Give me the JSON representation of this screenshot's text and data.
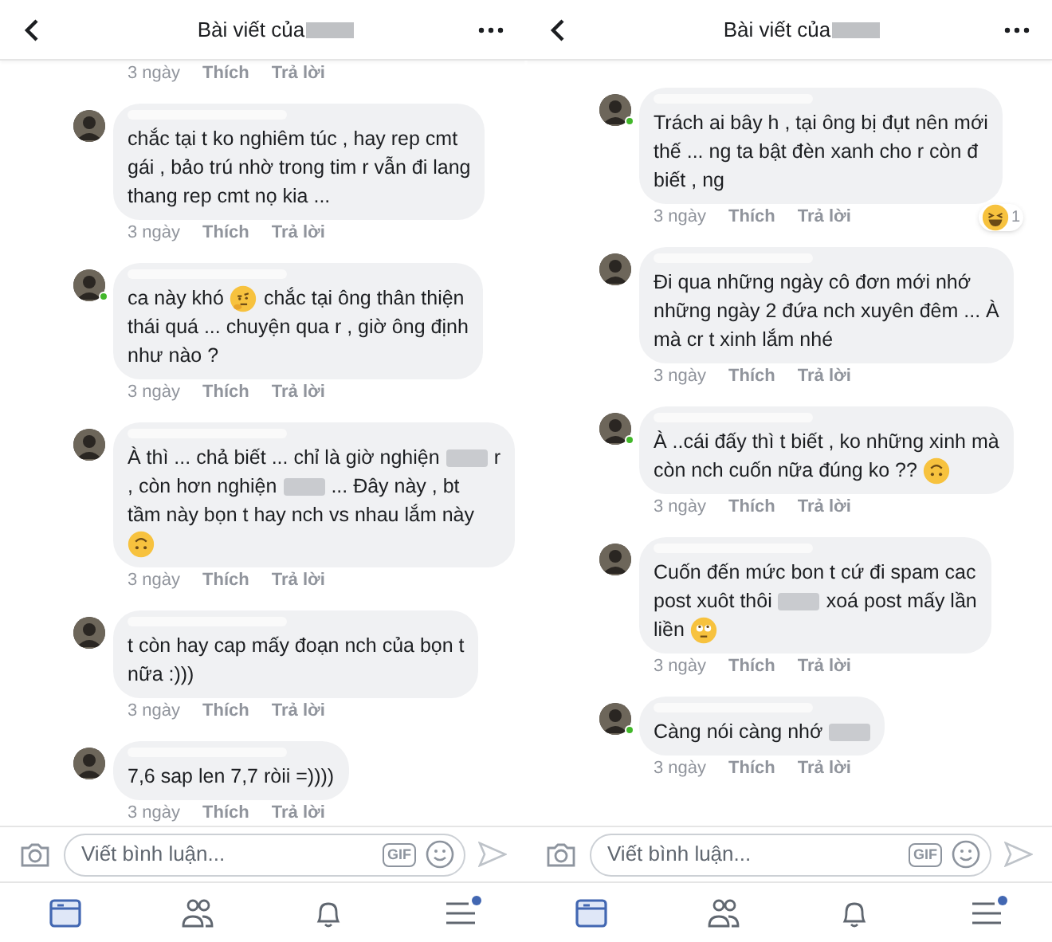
{
  "panels": [
    {
      "header": {
        "title": "Bài viết của"
      },
      "leading_actions": {
        "time": "3 ngày",
        "like": "Thích",
        "reply": "Trả lời"
      },
      "comments": [
        {
          "online": false,
          "lines": [
            [
              {
                "kind": "text",
                "text": "chắc tại t ko nghiêm túc  , hay rep cmt"
              }
            ],
            [
              {
                "kind": "text",
                "text": "gái ,  bảo trú nhờ trong tim r vẫn đi lang"
              }
            ],
            [
              {
                "kind": "text",
                "text": "thang rep cmt nọ kia ..."
              }
            ]
          ],
          "actions": {
            "time": "3 ngày",
            "like": "Thích",
            "reply": "Trả lời"
          }
        },
        {
          "online": true,
          "lines": [
            [
              {
                "kind": "text",
                "text": "ca này khó"
              },
              {
                "kind": "think"
              },
              {
                "kind": "text",
                "text": "chắc tại ông thân thiện"
              }
            ],
            [
              {
                "kind": "text",
                "text": "thái quá ... chuyện qua r , giờ ông định"
              }
            ],
            [
              {
                "kind": "text",
                "text": "như nào ?"
              }
            ]
          ],
          "actions": {
            "time": "3 ngày",
            "like": "Thích",
            "reply": "Trả lời"
          }
        },
        {
          "online": false,
          "lines": [
            [
              {
                "kind": "text",
                "text": "À thì ... chả biết ... chỉ là giờ nghiện"
              },
              {
                "kind": "blur"
              },
              {
                "kind": "text",
                "text": "r"
              }
            ],
            [
              {
                "kind": "text",
                "text": ", còn hơn nghiện"
              },
              {
                "kind": "blur"
              },
              {
                "kind": "text",
                "text": "... Đây này , bt"
              }
            ],
            [
              {
                "kind": "text",
                "text": "tầm này bọn t hay nch vs nhau lắm này"
              }
            ],
            [
              {
                "kind": "upside"
              }
            ]
          ],
          "actions": {
            "time": "3 ngày",
            "like": "Thích",
            "reply": "Trả lời"
          }
        },
        {
          "online": false,
          "lines": [
            [
              {
                "kind": "text",
                "text": "t còn hay cap mấy đoạn nch của bọn t"
              }
            ],
            [
              {
                "kind": "text",
                "text": "nữa :)))"
              }
            ]
          ],
          "actions": {
            "time": "3 ngày",
            "like": "Thích",
            "reply": "Trả lời"
          }
        },
        {
          "online": false,
          "lines": [
            [
              {
                "kind": "text",
                "text": "7,6 sap len 7,7 ròii =))))"
              }
            ]
          ],
          "actions": {
            "time": "3 ngày",
            "like": "Thích",
            "reply": "Trả lời"
          }
        }
      ],
      "composer": {
        "placeholder": "Viết bình luận...",
        "gif_label": "GIF"
      },
      "nav": [
        {
          "selected": true,
          "badge": false
        },
        {
          "selected": false,
          "badge": false
        },
        {
          "selected": false,
          "badge": false
        },
        {
          "selected": false,
          "badge": true
        }
      ]
    },
    {
      "header": {
        "title": "Bài viết của"
      },
      "comments": [
        {
          "online": true,
          "lines": [
            [
              {
                "kind": "text",
                "text": "Trách ai bây h , tại ông bị đụt nên mới"
              }
            ],
            [
              {
                "kind": "text",
                "text": "thế ... ng ta bật đèn xanh cho r còn đ"
              }
            ],
            [
              {
                "kind": "text",
                "text": "biết , ng"
              }
            ]
          ],
          "reaction": {
            "count": "1"
          },
          "actions": {
            "time": "3 ngày",
            "like": "Thích",
            "reply": "Trả lời"
          }
        },
        {
          "online": false,
          "lines": [
            [
              {
                "kind": "text",
                "text": "Đi qua những ngày cô đơn mới nhớ"
              }
            ],
            [
              {
                "kind": "text",
                "text": "những ngày 2 đứa nch xuyên đêm ... À"
              }
            ],
            [
              {
                "kind": "text",
                "text": "mà cr  t xinh lắm nhé"
              }
            ]
          ],
          "actions": {
            "time": "3 ngày",
            "like": "Thích",
            "reply": "Trả lời"
          }
        },
        {
          "online": true,
          "lines": [
            [
              {
                "kind": "text",
                "text": "À ..cái đấy thì t biết , ko những xinh mà"
              }
            ],
            [
              {
                "kind": "text",
                "text": "còn nch cuốn nữa đúng ko ??"
              },
              {
                "kind": "upside"
              }
            ]
          ],
          "actions": {
            "time": "3 ngày",
            "like": "Thích",
            "reply": "Trả lời"
          }
        },
        {
          "online": false,
          "lines": [
            [
              {
                "kind": "text",
                "text": "Cuốn đến mức bon t cứ đi spam cac"
              }
            ],
            [
              {
                "kind": "text",
                "text": "post xuôt thôi"
              },
              {
                "kind": "blur"
              },
              {
                "kind": "text",
                "text": "xoá post mấy lần"
              }
            ],
            [
              {
                "kind": "text",
                "text": "liền"
              },
              {
                "kind": "eyeroll"
              }
            ]
          ],
          "actions": {
            "time": "3 ngày",
            "like": "Thích",
            "reply": "Trả lời"
          }
        },
        {
          "online": true,
          "lines": [
            [
              {
                "kind": "text",
                "text": "Càng nói càng nhớ"
              },
              {
                "kind": "blur"
              }
            ]
          ],
          "actions": {
            "time": "3 ngày",
            "like": "Thích",
            "reply": "Trả lời"
          }
        }
      ],
      "composer": {
        "placeholder": "Viết bình luận...",
        "gif_label": "GIF"
      },
      "nav": [
        {
          "selected": true,
          "badge": false
        },
        {
          "selected": false,
          "badge": false
        },
        {
          "selected": false,
          "badge": false
        },
        {
          "selected": false,
          "badge": true
        }
      ]
    }
  ]
}
